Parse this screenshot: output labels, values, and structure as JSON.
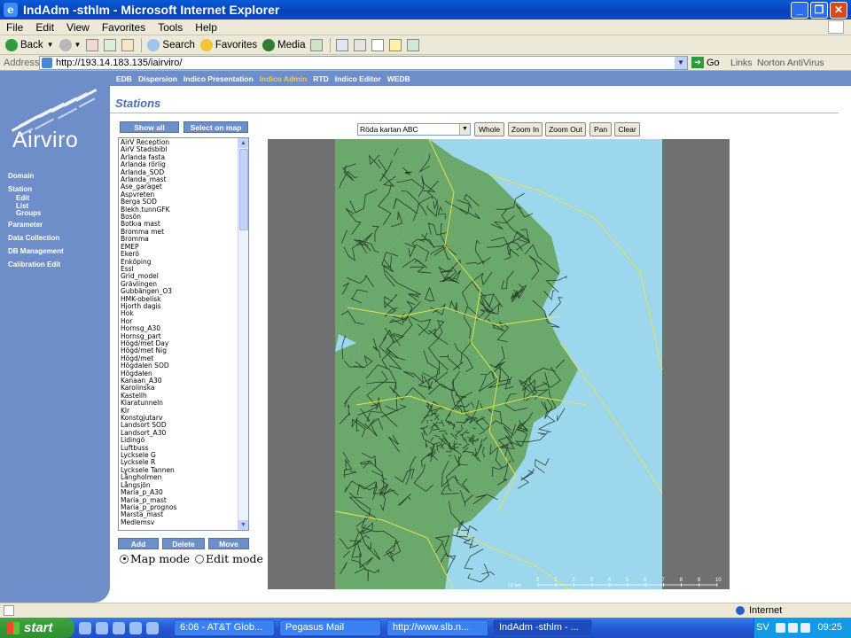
{
  "window": {
    "title": "IndAdm -sthlm - Microsoft Internet Explorer"
  },
  "menu": [
    "File",
    "Edit",
    "View",
    "Favorites",
    "Tools",
    "Help"
  ],
  "toolbar": {
    "back": "Back",
    "search": "Search",
    "favorites": "Favorites",
    "media": "Media"
  },
  "address": {
    "label": "Address",
    "url": "http://193.14.183.135/iairviro/",
    "go": "Go",
    "links": "Links",
    "norton": "Norton AntiVirus"
  },
  "app": {
    "logo": "Airviro",
    "topnav": [
      "EDB",
      "Dispersion",
      "Indico Presentation",
      "Indico Admin",
      "RTD",
      "Indico Editor",
      "WEDB"
    ],
    "topnav_active": "Indico Admin",
    "leftnav": {
      "domain": "Domain",
      "station": "Station",
      "station_sub": [
        "Edit",
        "List",
        "Groups"
      ],
      "parameter": "Parameter",
      "data_collection": "Data Collection",
      "db_management": "DB Management",
      "calibration_edit": "Calibration Edit"
    },
    "section_title": "Stations",
    "show_all": "Show all",
    "select_on_map": "Select on map",
    "stations": [
      "AirV Reception",
      "AirV Stadsbibl",
      "Arlanda fasta",
      "Arlanda rörlig",
      "Arlanda_SOD",
      "Arlanda_mast",
      "Ase_garaget",
      "Aspvreten",
      "Berga SOD",
      "Blekh.tunnGFK",
      "Bosön",
      "Botkıa mast",
      "Bromma met",
      "Bromma",
      "EMEP",
      "Ekerö",
      "Enköping",
      "Essl",
      "Grid_model",
      "Grävlingen",
      "Gubbängen_O3",
      "HMK-obelisk",
      "Hjorth dagis",
      "Hok",
      "Hor",
      "Hornsg_A30",
      "Hornsg_part",
      "Högd/met Day",
      "Högd/met Nig",
      "Högd/met",
      "Högdalen SOD",
      "Högdalen",
      "Kanaan_A30",
      "Karolinska",
      "Kastellh",
      "Klaratunneln",
      "Klr",
      "Konstgjutarv",
      "Landsort SOD",
      "Landsort_A30",
      "Lidingö",
      "Luftbuss",
      "Lycksele G",
      "Lycksele R",
      "Lycksele Tannen",
      "Långholmen",
      "Långsjön",
      "Maria_p_A30",
      "Maria_p_mast",
      "Maria_p_prognos",
      "Marsta_mast",
      "Medlemsv"
    ],
    "add": "Add",
    "delete": "Delete",
    "move": "Move",
    "map_mode": "Map mode",
    "edit_mode": "Edit mode",
    "map_select": "Röda kartan ABC",
    "map_buttons": [
      "Whole",
      "Zoom In",
      "Zoom Out",
      "Pan",
      "Clear"
    ],
    "scale_label": "10 km",
    "scale_ticks": [
      "0",
      "1",
      "2",
      "3",
      "4",
      "5",
      "6",
      "7",
      "8",
      "9",
      "10"
    ]
  },
  "status": {
    "zone": "Internet"
  },
  "taskbar": {
    "start": "start",
    "tasks": [
      "6:06 - AT&T Glob...",
      "Pegasus Mail",
      "http://www.slb.n...",
      "IndAdm -sthlm - ..."
    ],
    "lang": "SV",
    "clock": "09:25"
  },
  "colors": {
    "nav": "#6d8ec9",
    "sea": "#9dd7ed",
    "land": "#6aa86b",
    "roads": "#1a2a1a",
    "borders": "#e8e04a",
    "accent": "#f3c65f"
  }
}
